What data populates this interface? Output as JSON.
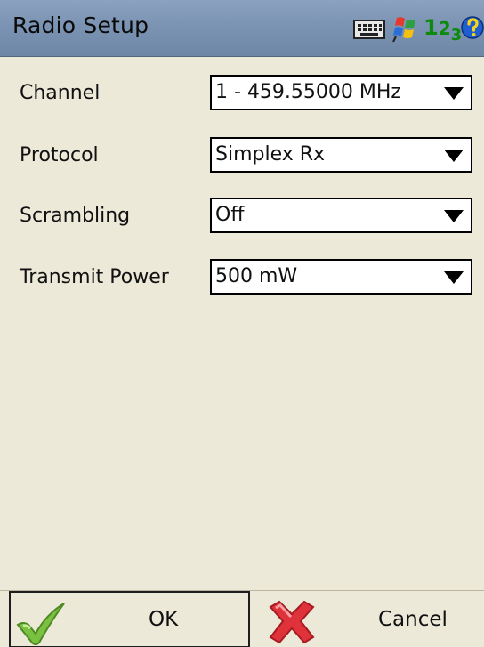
{
  "window": {
    "title": "Radio Setup",
    "tray": {
      "keyboard_icon": "keyboard-icon",
      "start_icon": "windows-start-icon",
      "input_mode_text": [
        "1",
        "2",
        "3"
      ],
      "help_icon": "help-icon"
    }
  },
  "form": {
    "fields": [
      {
        "label": "Channel",
        "value": "1 - 459.55000 MHz"
      },
      {
        "label": "Protocol",
        "value": "Simplex Rx"
      },
      {
        "label": "Scrambling",
        "value": "Off"
      },
      {
        "label": "Transmit Power",
        "value": "500 mW"
      }
    ]
  },
  "buttons": {
    "ok_label": "OK",
    "cancel_label": "Cancel"
  },
  "colors": {
    "titlebar": "#7d95b4",
    "background": "#ece9d8",
    "ok_check": "#7ac142",
    "cancel_x": "#e0323a"
  }
}
